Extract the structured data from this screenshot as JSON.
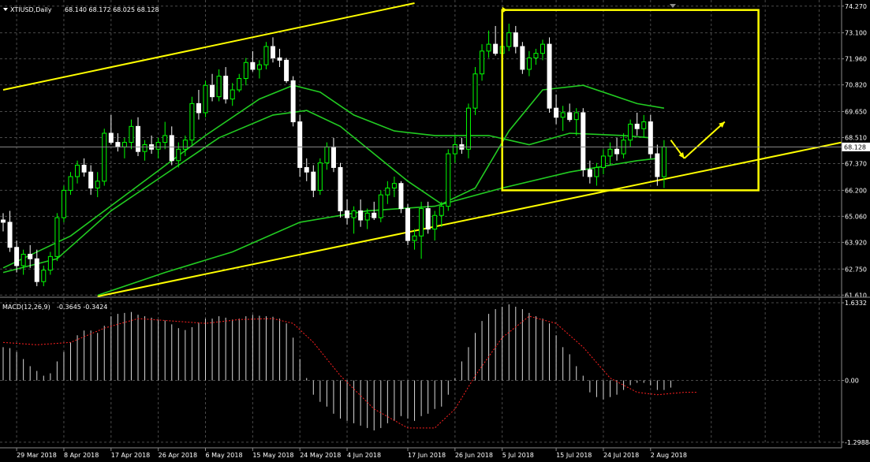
{
  "header": {
    "symbol": "XTIUSD,Daily",
    "ohlc": "68.140 68.172 68.025 68.128"
  },
  "macd_header": {
    "label": "MACD(12,26,9)",
    "values": "-0.3645 -0.3424"
  },
  "current_price": "68.128",
  "colors": {
    "background": "#000000",
    "grid": "#4a4a4a",
    "bull": "#00ff00",
    "bear": "#ffffff",
    "ma": "#22cc22",
    "trend": "#ffff00",
    "macd_hist": "#d9d9d9",
    "macd_signal": "#ff2020",
    "price_tag_bg": "#ffffff",
    "price_tag_text": "#000000"
  },
  "chart_data": [
    {
      "type": "candlestick",
      "panel": "price",
      "y_ticks": [
        "74.270",
        "73.100",
        "71.960",
        "70.820",
        "69.650",
        "68.510",
        "67.370",
        "66.200",
        "65.060",
        "63.920",
        "62.750",
        "61.610"
      ],
      "y_tick_values": [
        74.27,
        73.1,
        71.96,
        70.82,
        69.65,
        68.51,
        67.37,
        66.2,
        65.06,
        63.92,
        62.75,
        61.61
      ],
      "ylim": [
        61.55,
        74.4
      ],
      "x_ticks": [
        "29 Mar 2018",
        "8 Apr 2018",
        "17 Apr 2018",
        "26 Apr 2018",
        "6 May 2018",
        "15 May 2018",
        "24 May 2018",
        "4 Jun 2018",
        "17 Jun 2018",
        "26 Jun 2018",
        "5 Jul 2018",
        "15 Jul 2018",
        "24 Jul 2018",
        "2 Aug 2018"
      ],
      "x_tick_index": [
        2,
        9,
        16,
        23,
        30,
        37,
        44,
        51,
        60,
        67,
        74,
        82,
        89,
        96
      ],
      "candles": [
        {
          "o": 64.9,
          "h": 65.2,
          "l": 64.4,
          "c": 64.8
        },
        {
          "o": 64.8,
          "h": 65.3,
          "l": 63.5,
          "c": 63.7
        },
        {
          "o": 63.7,
          "h": 64.0,
          "l": 62.6,
          "c": 62.9
        },
        {
          "o": 62.9,
          "h": 63.6,
          "l": 62.5,
          "c": 63.4
        },
        {
          "o": 63.4,
          "h": 63.8,
          "l": 62.8,
          "c": 63.2
        },
        {
          "o": 63.2,
          "h": 63.6,
          "l": 62.0,
          "c": 62.2
        },
        {
          "o": 62.2,
          "h": 62.9,
          "l": 62.0,
          "c": 62.7
        },
        {
          "o": 62.7,
          "h": 63.5,
          "l": 62.5,
          "c": 63.3
        },
        {
          "o": 63.3,
          "h": 65.2,
          "l": 63.1,
          "c": 65.0
        },
        {
          "o": 65.0,
          "h": 66.4,
          "l": 64.8,
          "c": 66.2
        },
        {
          "o": 66.2,
          "h": 67.0,
          "l": 66.0,
          "c": 66.8
        },
        {
          "o": 66.8,
          "h": 67.5,
          "l": 66.5,
          "c": 67.3
        },
        {
          "o": 67.3,
          "h": 67.6,
          "l": 66.8,
          "c": 67.0
        },
        {
          "o": 67.0,
          "h": 67.3,
          "l": 66.0,
          "c": 66.3
        },
        {
          "o": 66.3,
          "h": 67.0,
          "l": 65.9,
          "c": 66.6
        },
        {
          "o": 66.6,
          "h": 68.9,
          "l": 66.4,
          "c": 68.7
        },
        {
          "o": 68.7,
          "h": 69.5,
          "l": 68.2,
          "c": 68.3
        },
        {
          "o": 68.3,
          "h": 68.7,
          "l": 67.9,
          "c": 68.1
        },
        {
          "o": 68.1,
          "h": 68.5,
          "l": 67.6,
          "c": 68.3
        },
        {
          "o": 68.3,
          "h": 69.3,
          "l": 68.0,
          "c": 69.0
        },
        {
          "o": 69.0,
          "h": 69.4,
          "l": 67.7,
          "c": 67.9
        },
        {
          "o": 67.9,
          "h": 68.4,
          "l": 67.5,
          "c": 68.2
        },
        {
          "o": 68.2,
          "h": 68.6,
          "l": 67.8,
          "c": 68.0
        },
        {
          "o": 68.0,
          "h": 68.5,
          "l": 67.6,
          "c": 68.3
        },
        {
          "o": 68.3,
          "h": 69.2,
          "l": 68.0,
          "c": 68.6
        },
        {
          "o": 68.6,
          "h": 69.0,
          "l": 67.3,
          "c": 67.5
        },
        {
          "o": 67.5,
          "h": 68.3,
          "l": 67.2,
          "c": 68.0
        },
        {
          "o": 68.0,
          "h": 68.6,
          "l": 67.7,
          "c": 68.4
        },
        {
          "o": 68.4,
          "h": 70.3,
          "l": 68.2,
          "c": 70.0
        },
        {
          "o": 70.0,
          "h": 70.6,
          "l": 69.3,
          "c": 69.6
        },
        {
          "o": 69.6,
          "h": 71.0,
          "l": 69.4,
          "c": 70.8
        },
        {
          "o": 70.8,
          "h": 71.3,
          "l": 70.1,
          "c": 70.3
        },
        {
          "o": 70.3,
          "h": 71.5,
          "l": 70.1,
          "c": 71.2
        },
        {
          "o": 71.2,
          "h": 71.6,
          "l": 70.0,
          "c": 70.2
        },
        {
          "o": 70.2,
          "h": 70.9,
          "l": 69.9,
          "c": 70.6
        },
        {
          "o": 70.6,
          "h": 71.3,
          "l": 70.5,
          "c": 71.1
        },
        {
          "o": 71.1,
          "h": 72.0,
          "l": 70.8,
          "c": 71.8
        },
        {
          "o": 71.8,
          "h": 72.3,
          "l": 71.4,
          "c": 71.5
        },
        {
          "o": 71.5,
          "h": 71.9,
          "l": 71.1,
          "c": 71.7
        },
        {
          "o": 71.7,
          "h": 72.7,
          "l": 71.5,
          "c": 72.5
        },
        {
          "o": 72.5,
          "h": 72.9,
          "l": 71.8,
          "c": 72.0
        },
        {
          "o": 72.0,
          "h": 72.4,
          "l": 71.6,
          "c": 71.9
        },
        {
          "o": 71.9,
          "h": 72.0,
          "l": 70.9,
          "c": 71.0
        },
        {
          "o": 71.0,
          "h": 71.2,
          "l": 69.0,
          "c": 69.2
        },
        {
          "o": 69.2,
          "h": 69.5,
          "l": 66.8,
          "c": 67.2
        },
        {
          "o": 67.2,
          "h": 67.6,
          "l": 66.6,
          "c": 67.0
        },
        {
          "o": 67.0,
          "h": 67.3,
          "l": 65.9,
          "c": 66.2
        },
        {
          "o": 66.2,
          "h": 67.6,
          "l": 66.0,
          "c": 67.4
        },
        {
          "o": 67.4,
          "h": 68.3,
          "l": 67.1,
          "c": 68.1
        },
        {
          "o": 68.1,
          "h": 68.5,
          "l": 67.0,
          "c": 67.2
        },
        {
          "o": 67.2,
          "h": 67.4,
          "l": 65.0,
          "c": 65.3
        },
        {
          "o": 65.3,
          "h": 65.8,
          "l": 64.7,
          "c": 65.0
        },
        {
          "o": 65.0,
          "h": 65.5,
          "l": 64.3,
          "c": 65.3
        },
        {
          "o": 65.3,
          "h": 65.8,
          "l": 64.6,
          "c": 64.9
        },
        {
          "o": 64.9,
          "h": 65.4,
          "l": 64.5,
          "c": 65.2
        },
        {
          "o": 65.2,
          "h": 65.7,
          "l": 64.9,
          "c": 65.0
        },
        {
          "o": 65.0,
          "h": 66.2,
          "l": 64.8,
          "c": 66.0
        },
        {
          "o": 66.0,
          "h": 66.6,
          "l": 65.6,
          "c": 66.3
        },
        {
          "o": 66.3,
          "h": 66.8,
          "l": 65.9,
          "c": 66.5
        },
        {
          "o": 66.5,
          "h": 66.6,
          "l": 65.2,
          "c": 65.4
        },
        {
          "o": 65.4,
          "h": 65.6,
          "l": 63.8,
          "c": 64.0
        },
        {
          "o": 64.0,
          "h": 64.5,
          "l": 63.6,
          "c": 64.2
        },
        {
          "o": 64.2,
          "h": 65.7,
          "l": 63.2,
          "c": 65.4
        },
        {
          "o": 65.4,
          "h": 65.7,
          "l": 64.3,
          "c": 64.5
        },
        {
          "o": 64.5,
          "h": 65.3,
          "l": 64.0,
          "c": 65.1
        },
        {
          "o": 65.1,
          "h": 65.7,
          "l": 64.6,
          "c": 65.5
        },
        {
          "o": 65.5,
          "h": 68.0,
          "l": 65.3,
          "c": 67.8
        },
        {
          "o": 67.8,
          "h": 68.6,
          "l": 67.4,
          "c": 68.2
        },
        {
          "o": 68.2,
          "h": 68.5,
          "l": 67.8,
          "c": 68.0
        },
        {
          "o": 68.0,
          "h": 70.0,
          "l": 67.6,
          "c": 69.8
        },
        {
          "o": 69.8,
          "h": 71.6,
          "l": 69.5,
          "c": 71.3
        },
        {
          "o": 71.3,
          "h": 72.6,
          "l": 71.0,
          "c": 72.3
        },
        {
          "o": 72.3,
          "h": 73.2,
          "l": 72.0,
          "c": 72.6
        },
        {
          "o": 72.6,
          "h": 73.4,
          "l": 72.1,
          "c": 72.2
        },
        {
          "o": 72.2,
          "h": 72.7,
          "l": 71.6,
          "c": 72.5
        },
        {
          "o": 72.5,
          "h": 73.5,
          "l": 72.3,
          "c": 73.1
        },
        {
          "o": 73.1,
          "h": 73.4,
          "l": 72.2,
          "c": 72.5
        },
        {
          "o": 72.5,
          "h": 72.7,
          "l": 71.3,
          "c": 71.5
        },
        {
          "o": 71.5,
          "h": 72.3,
          "l": 71.2,
          "c": 72.0
        },
        {
          "o": 72.0,
          "h": 72.4,
          "l": 71.7,
          "c": 72.2
        },
        {
          "o": 72.2,
          "h": 72.8,
          "l": 71.9,
          "c": 72.6
        },
        {
          "o": 72.6,
          "h": 72.9,
          "l": 69.6,
          "c": 69.8
        },
        {
          "o": 69.8,
          "h": 70.4,
          "l": 69.1,
          "c": 69.4
        },
        {
          "o": 69.4,
          "h": 69.9,
          "l": 68.8,
          "c": 69.6
        },
        {
          "o": 69.6,
          "h": 70.0,
          "l": 69.2,
          "c": 69.3
        },
        {
          "o": 69.3,
          "h": 69.8,
          "l": 68.6,
          "c": 69.6
        },
        {
          "o": 69.6,
          "h": 69.8,
          "l": 66.8,
          "c": 67.1
        },
        {
          "o": 67.1,
          "h": 67.5,
          "l": 66.5,
          "c": 66.8
        },
        {
          "o": 66.8,
          "h": 67.4,
          "l": 66.4,
          "c": 67.2
        },
        {
          "o": 67.2,
          "h": 68.0,
          "l": 66.9,
          "c": 67.7
        },
        {
          "o": 67.7,
          "h": 68.3,
          "l": 67.3,
          "c": 68.0
        },
        {
          "o": 68.0,
          "h": 68.5,
          "l": 67.5,
          "c": 67.8
        },
        {
          "o": 67.8,
          "h": 68.7,
          "l": 67.6,
          "c": 68.4
        },
        {
          "o": 68.4,
          "h": 69.3,
          "l": 68.1,
          "c": 69.1
        },
        {
          "o": 69.1,
          "h": 69.6,
          "l": 68.6,
          "c": 68.9
        },
        {
          "o": 68.9,
          "h": 69.5,
          "l": 68.5,
          "c": 69.2
        },
        {
          "o": 69.2,
          "h": 69.5,
          "l": 67.6,
          "c": 67.8
        },
        {
          "o": 67.8,
          "h": 68.2,
          "l": 66.4,
          "c": 66.8
        },
        {
          "o": 66.8,
          "h": 68.4,
          "l": 66.3,
          "c": 68.1
        }
      ],
      "moving_averages": [
        {
          "values": [
            [
              0,
              62.8
            ],
            [
              10,
              64.2
            ],
            [
              20,
              66.4
            ],
            [
              30,
              68.6
            ],
            [
              38,
              70.2
            ],
            [
              43,
              70.8
            ],
            [
              47,
              70.5
            ],
            [
              52,
              69.5
            ],
            [
              58,
              68.8
            ],
            [
              64,
              68.6
            ],
            [
              72,
              68.6
            ],
            [
              78,
              68.2
            ],
            [
              84,
              68.7
            ],
            [
              92,
              68.6
            ],
            [
              96,
              68.5
            ]
          ]
        },
        {
          "values": [
            [
              0,
              62.6
            ],
            [
              8,
              63.2
            ],
            [
              16,
              65.3
            ],
            [
              24,
              66.9
            ],
            [
              32,
              68.5
            ],
            [
              40,
              69.5
            ],
            [
              45,
              69.7
            ],
            [
              50,
              69.0
            ],
            [
              55,
              67.8
            ],
            [
              60,
              66.6
            ],
            [
              65,
              65.6
            ],
            [
              70,
              66.3
            ],
            [
              75,
              68.8
            ],
            [
              80,
              70.6
            ],
            [
              86,
              70.8
            ],
            [
              94,
              70.0
            ],
            [
              98,
              69.8
            ]
          ]
        },
        {
          "values": [
            [
              14,
              61.6
            ],
            [
              24,
              62.6
            ],
            [
              34,
              63.5
            ],
            [
              44,
              64.8
            ],
            [
              54,
              65.3
            ],
            [
              64,
              65.5
            ],
            [
              74,
              66.3
            ],
            [
              84,
              67.0
            ],
            [
              94,
              67.5
            ],
            [
              97,
              67.6
            ]
          ]
        }
      ],
      "trend_lines": [
        {
          "from": [
            0,
            70.6
          ],
          "to": [
            61,
            74.4
          ]
        },
        {
          "from": [
            14,
            61.55
          ],
          "to": [
            128,
            68.3
          ]
        }
      ],
      "annotation_box": {
        "x_from": 74,
        "x_to": 112,
        "y_from": 66.2,
        "y_to": 74.1
      },
      "arrows": [
        {
          "from": [
            99,
            68.4
          ],
          "to": [
            101,
            67.6
          ]
        },
        {
          "from": [
            101,
            67.6
          ],
          "to": [
            107,
            69.2
          ]
        }
      ]
    },
    {
      "type": "bar",
      "panel": "macd",
      "y_ticks": [
        "1.6332",
        "0.00",
        "-1.29884"
      ],
      "y_tick_values": [
        1.6332,
        0.0,
        -1.29884
      ],
      "ylim": [
        -1.35,
        1.7
      ],
      "histogram": [
        0.7,
        0.68,
        0.6,
        0.45,
        0.3,
        0.2,
        0.1,
        0.15,
        0.4,
        0.6,
        0.8,
        0.95,
        1.05,
        1.05,
        1.0,
        1.15,
        1.35,
        1.4,
        1.42,
        1.44,
        1.38,
        1.35,
        1.32,
        1.28,
        1.26,
        1.18,
        1.1,
        1.06,
        1.12,
        1.22,
        1.3,
        1.3,
        1.35,
        1.32,
        1.28,
        1.3,
        1.35,
        1.38,
        1.36,
        1.35,
        1.34,
        1.3,
        1.2,
        0.9,
        0.45,
        0.05,
        -0.3,
        -0.45,
        -0.55,
        -0.7,
        -0.8,
        -0.85,
        -0.9,
        -0.95,
        -1.0,
        -1.05,
        -1.0,
        -0.9,
        -0.85,
        -0.75,
        -0.8,
        -0.85,
        -0.75,
        -0.7,
        -0.6,
        -0.55,
        -0.3,
        0.05,
        0.4,
        0.7,
        1.0,
        1.25,
        1.4,
        1.5,
        1.55,
        1.6,
        1.55,
        1.5,
        1.42,
        1.35,
        1.3,
        1.2,
        0.95,
        0.7,
        0.55,
        0.3,
        0.1,
        -0.25,
        -0.35,
        -0.4,
        -0.35,
        -0.3,
        -0.2,
        -0.1,
        -0.05,
        -0.05,
        -0.1,
        -0.2,
        -0.2,
        -0.15
      ],
      "signal": [
        [
          0,
          0.8
        ],
        [
          5,
          0.75
        ],
        [
          10,
          0.8
        ],
        [
          15,
          1.1
        ],
        [
          20,
          1.3
        ],
        [
          25,
          1.25
        ],
        [
          30,
          1.2
        ],
        [
          35,
          1.28
        ],
        [
          40,
          1.3
        ],
        [
          43,
          1.2
        ],
        [
          46,
          0.8
        ],
        [
          50,
          0.1
        ],
        [
          55,
          -0.6
        ],
        [
          60,
          -1.0
        ],
        [
          64,
          -1.0
        ],
        [
          67,
          -0.6
        ],
        [
          70,
          0.1
        ],
        [
          74,
          0.9
        ],
        [
          78,
          1.35
        ],
        [
          82,
          1.2
        ],
        [
          86,
          0.7
        ],
        [
          90,
          0.05
        ],
        [
          94,
          -0.25
        ],
        [
          97,
          -0.3
        ],
        [
          101,
          -0.25
        ],
        [
          103,
          -0.25
        ]
      ]
    }
  ]
}
